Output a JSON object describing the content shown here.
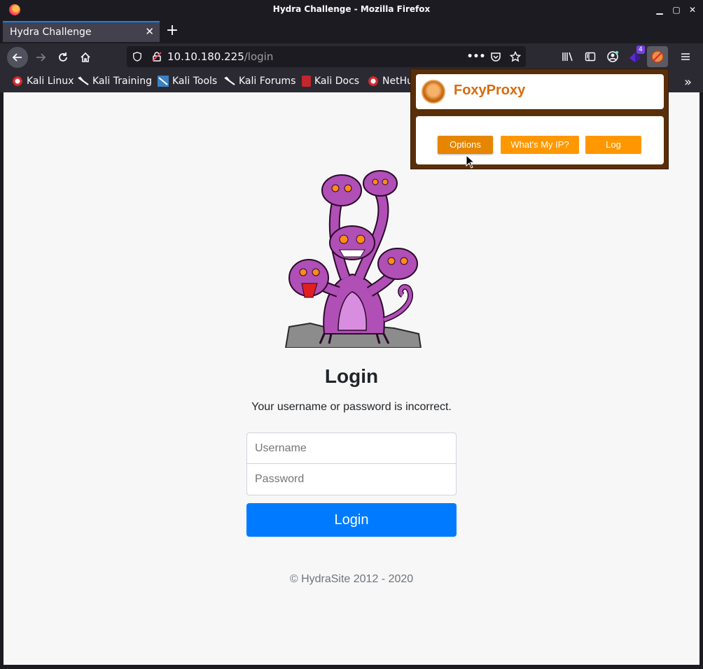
{
  "window": {
    "title": "Hydra Challenge - Mozilla Firefox",
    "minimize": "▁",
    "maximize": "▢",
    "close": "✕"
  },
  "tabs": [
    {
      "label": "Hydra Challenge",
      "close": "✕"
    }
  ],
  "newtab_label": "+",
  "url": {
    "host": "10.10.180.225",
    "path": "/login"
  },
  "toolbar": {
    "extension_badge": "4",
    "icons": [
      "library-icon",
      "sidebar-icon",
      "account-icon",
      "extension-icon",
      "foxyproxy-icon",
      "menu-icon"
    ]
  },
  "bookmarks": [
    {
      "label": "Kali Linux"
    },
    {
      "label": "Kali Training"
    },
    {
      "label": "Kali Tools"
    },
    {
      "label": "Kali Forums"
    },
    {
      "label": "Kali Docs"
    },
    {
      "label": "NetHu"
    }
  ],
  "bookmarks_more": "»",
  "page": {
    "title": "Login",
    "message": "Your username or password is incorrect.",
    "username_placeholder": "Username",
    "password_placeholder": "Password",
    "login_label": "Login",
    "footer": "© HydraSite 2012 - 2020"
  },
  "foxyproxy": {
    "title": "FoxyProxy",
    "buttons": {
      "options": "Options",
      "whats_my_ip": "What's My IP?",
      "log": "Log"
    },
    "accent": "#ff9800"
  },
  "colors": {
    "primary": "#007bff",
    "tab_accent": "#0a84ff"
  }
}
